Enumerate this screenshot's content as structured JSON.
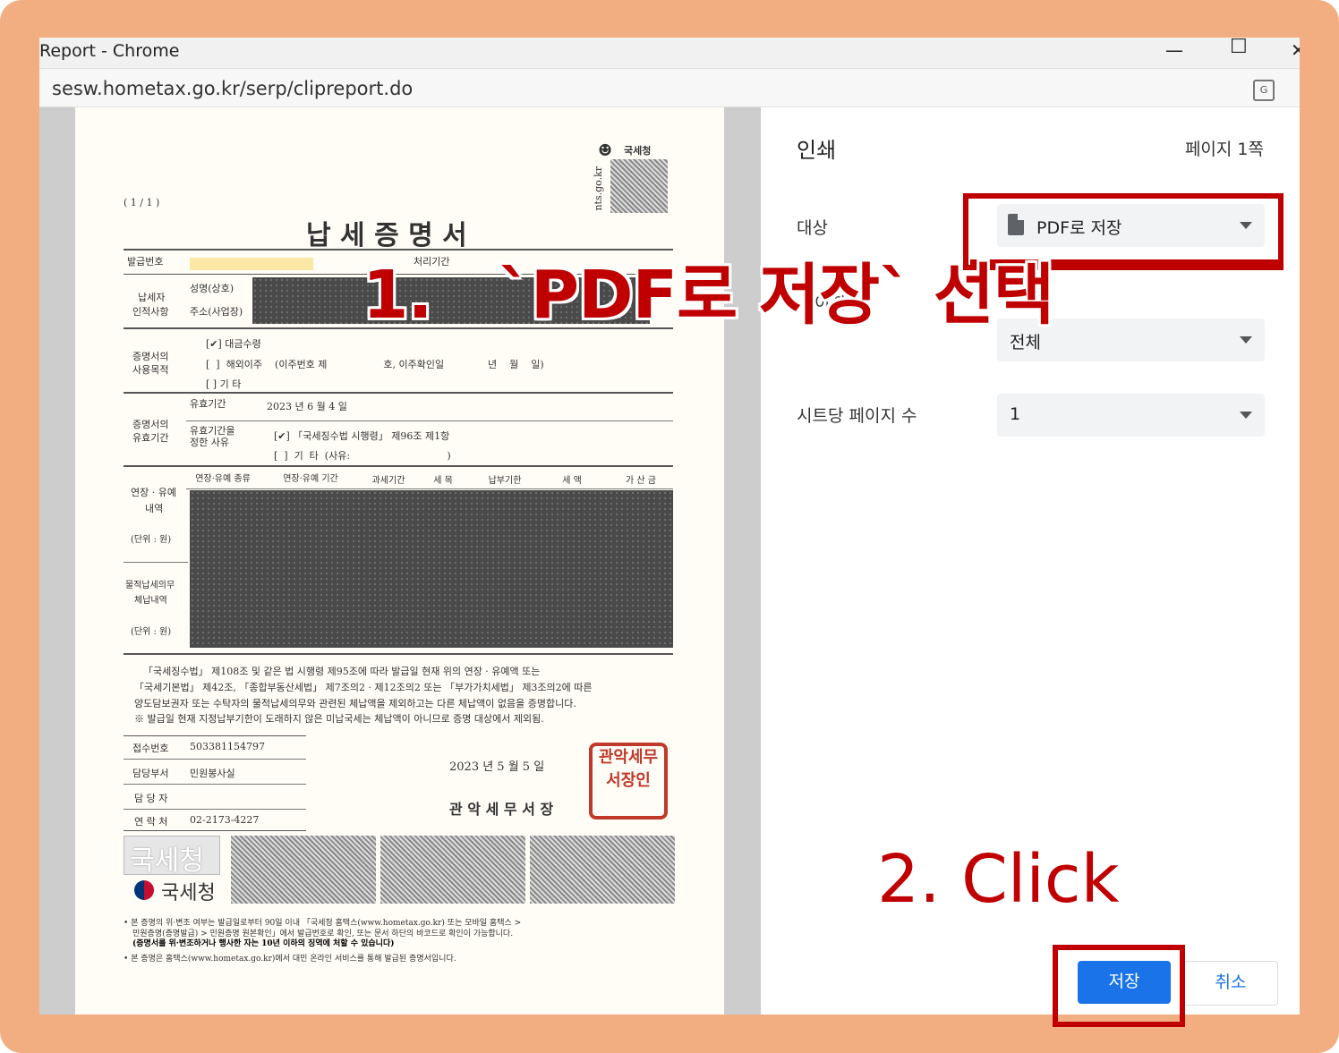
{
  "window": {
    "title": "Report - Chrome",
    "minimize": "—",
    "maximize": "☐",
    "close": "✕",
    "url": "sesw.hometax.go.kr/serp/clipreport.do",
    "translate_icon": "translate-icon"
  },
  "print_panel": {
    "title": "인쇄",
    "page_count": "페이지 1쪽",
    "destination_label": "대상",
    "destination_value": "PDF로 저장",
    "pages_label": "이지",
    "pages_value": "전체",
    "pages_per_sheet_label": "시트당 페이지 수",
    "pages_per_sheet_value": "1",
    "save_button": "저장",
    "cancel_button": "취소"
  },
  "annotations": {
    "step1": "1.   `PDF로 저장` 선택",
    "step2": "2. Click",
    "color": "#c00000"
  },
  "document": {
    "agency": "국세청",
    "site": "nts.go.kr",
    "page": "( 1 / 1 )",
    "title": "납 세 증 명 서",
    "issue_no_label": "발급번호",
    "processing_label": "처리기간",
    "taxpayer_label1": "납세자",
    "taxpayer_label2": "인적사항",
    "name_label": "성명(상호)",
    "address_label": "주소(사업장)",
    "purpose_label1": "증명서의",
    "purpose_label2": "사용목적",
    "purpose1": "[✔]  대금수령",
    "purpose2": "[  ]  해외이주    (이주번호 제                  호, 이주확인일              년    월    일)",
    "purpose3": "[  ]  기   타",
    "validity_label1": "증명서의",
    "validity_label2": "유효기간",
    "valid_period_label": "유효기간",
    "valid_period": "2023 년  6 월  4 일",
    "valid_reason_label1": "유효기간을",
    "valid_reason_label2": "정한 사유",
    "valid_reason1": "[✔]   「국세징수법 시행령」 제96조 제1항",
    "valid_reason2": "[  ]  기  타  (사유:                               )",
    "table_headers": [
      "연장·유예 종류",
      "연장·유예 기간",
      "과세기간",
      "세 목",
      "납부기한",
      "세 액",
      "가 산 금"
    ],
    "deferral_label1": "연장 · 유예",
    "deferral_label2": "내역",
    "deferral_unit": "(단위 : 원)",
    "inkind_label1": "물적납세의무",
    "inkind_label2": "체납내역",
    "inkind_unit": "(단위 : 원)",
    "statement1": "「국세징수법」 제108조 및 같은 법 시행령 제95조에 따라 발급일 현재 위의 연장 · 유예액 또는",
    "statement2": "「국세기본법」 제42조, 「종합부동산세법」 제7조의2 · 제12조의2 또는 「부가가치세법」 제3조의2에 따른",
    "statement3": "양도담보권자 또는 수탁자의 물적납세의무와 관련된 체납액을 제외하고는 다른 체납액이 없음을 증명합니다.",
    "statement4": "※ 발급일 현재 지정납부기한이 도래하지 않은 미납국세는 체납액이 아니므로 증명 대상에서 제외됨.",
    "receipt_label": "접수번호",
    "receipt_no": "503381154797",
    "dept_label": "담당부서",
    "dept": "민원봉사실",
    "person_label": "담 당 자",
    "contact_label": "연 락 처",
    "contact": "02-2173-4227",
    "date": "2023 년   5 월   5 일",
    "office": "관 악 세 무 서 장",
    "seal_text": "관악세무서장인",
    "watermark": "국세청",
    "logo_text": "국세청",
    "foot1": "• 본 증명의 위·변조 여부는 발급일로부터 90일 이내 「국세청 홈택스(www.hometax.go.kr) 또는 모바일 홈택스 >",
    "foot2": "민원증명(증명발급) > 민원증명 원본확인」에서 발급번호로 확인, 또는 문서 하단의 바코드로 확인이 가능합니다.",
    "foot3": "(증명서를 위·변조하거나 행사한 자는 10년 이하의 징역에 처할 수 있습니다)",
    "foot4": "• 본 증명은 홈택스(www.hometax.go.kr)에서 대민 온라인 서비스를 통해 발급된 증명서입니다."
  }
}
